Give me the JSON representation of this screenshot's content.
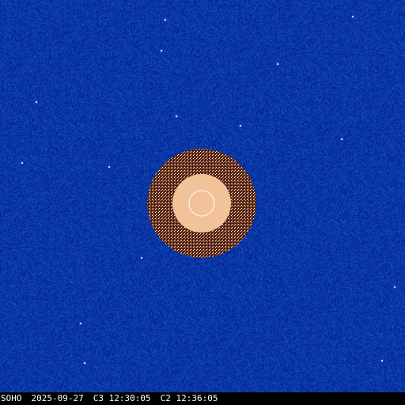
{
  "image": {
    "sky_color": "#0d3aa8",
    "occulter_color": "#f2c398",
    "inner_field_tint": "#8c3a1a",
    "sun_outline_color": "#ffffff"
  },
  "caption": {
    "observatory": "SOHO",
    "date": "2025-09-27",
    "c3_time": "C3 12:30:05",
    "c2_time": "C2 12:36:05"
  }
}
